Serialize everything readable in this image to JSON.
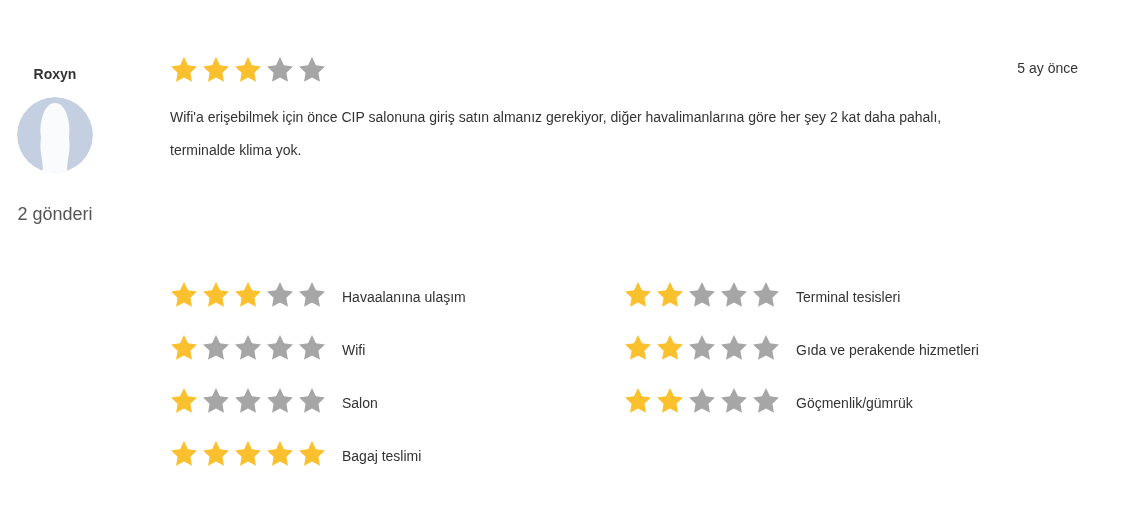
{
  "reviewer": {
    "name": "Roxyn",
    "posts": "2 gönderi"
  },
  "review": {
    "stars": 3,
    "date": "5 ay önce",
    "text": "Wifi'a erişebilmek için önce CIP salonuna giriş satın almanız gerekiyor, diğer havalimanlarına göre her şey 2 kat daha pahalı, terminalde klima yok."
  },
  "ratings": [
    {
      "label": "Havaalanına ulaşım",
      "stars": 3
    },
    {
      "label": "Terminal tesisleri",
      "stars": 2
    },
    {
      "label": "Wifi",
      "stars": 1
    },
    {
      "label": "Gıda ve perakende hizmetleri",
      "stars": 2
    },
    {
      "label": "Salon",
      "stars": 1
    },
    {
      "label": "Göçmenlik/gümrük",
      "stars": 2
    },
    {
      "label": "Bagaj teslimi",
      "stars": 5
    }
  ]
}
